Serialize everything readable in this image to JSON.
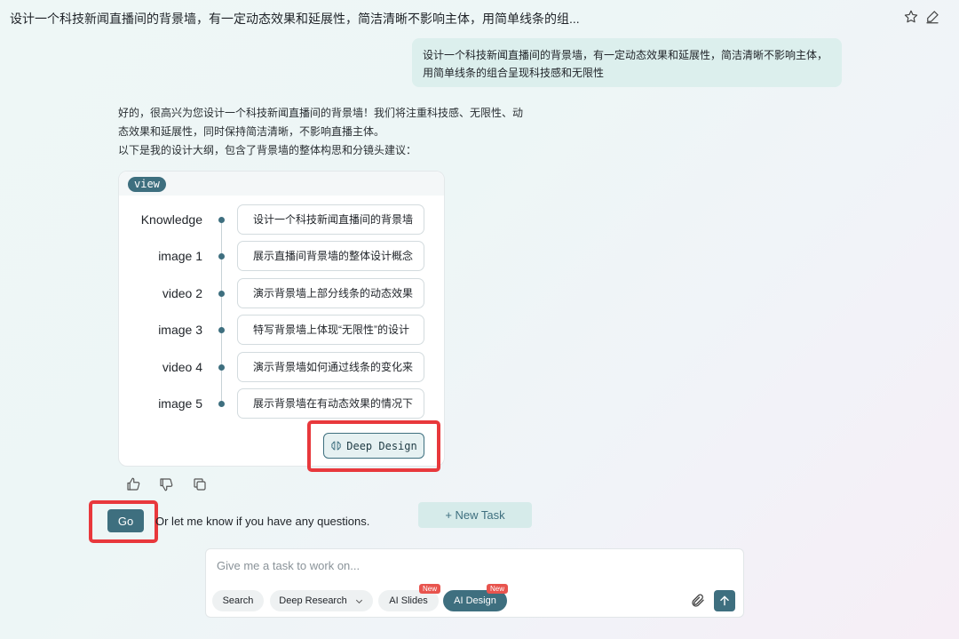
{
  "header": {
    "title": "设计一个科技新闻直播间的背景墙，有一定动态效果和延展性，简洁清晰不影响主体，用简单线条的组..."
  },
  "user_message": {
    "line1": "设计一个科技新闻直播间的背景墙，有一定动态效果和延展性，简洁清晰不影响主体，",
    "line2": "用简单线条的组合呈现科技感和无限性"
  },
  "assistant": {
    "line1": "好的，很高兴为您设计一个科技新闻直播间的背景墙！我们将注重科技感、无限性、动",
    "line2": "态效果和延展性，同时保持简洁清晰，不影响直播主体。",
    "line3": "以下是我的设计大纲，包含了背景墙的整体构思和分镜头建议："
  },
  "view_card": {
    "tag": "view",
    "rows": [
      {
        "label": "Knowledge",
        "text": "设计一个科技新闻直播间的背景墙"
      },
      {
        "label": "image 1",
        "text": "展示直播间背景墙的整体设计概念"
      },
      {
        "label": "video 2",
        "text": "演示背景墙上部分线条的动态效果"
      },
      {
        "label": "image 3",
        "text": "特写背景墙上体现“无限性”的设计"
      },
      {
        "label": "video 4",
        "text": "演示背景墙如何通过线条的变化来"
      },
      {
        "label": "image 5",
        "text": "展示背景墙在有动态效果的情况下"
      }
    ],
    "deep_design_label": "Deep Design"
  },
  "actions": {
    "go_label": "Go",
    "go_hint": "Or let me know if you have any questions.",
    "new_task_label": "+ New Task"
  },
  "composer": {
    "placeholder": "Give me a task to work on...",
    "tools": {
      "search": "Search",
      "deep_research": "Deep Research",
      "ai_slides": "AI Slides",
      "ai_design": "AI Design",
      "badge": "New"
    }
  },
  "colors": {
    "accent": "#3e6f7f",
    "highlight_box": "#e8383c",
    "user_bubble": "#dcefed",
    "new_badge": "#e8544e"
  }
}
